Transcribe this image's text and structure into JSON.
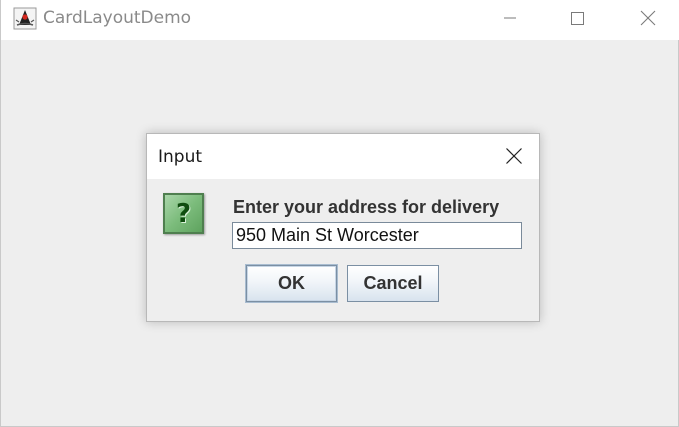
{
  "window": {
    "title": "CardLayoutDemo",
    "app_icon": "java-duke-icon",
    "controls": {
      "minimize_icon": "minimize-icon",
      "maximize_icon": "maximize-icon",
      "close_icon": "close-icon"
    }
  },
  "dialog": {
    "title": "Input",
    "close_icon": "close-icon",
    "message_icon": "question-icon",
    "message_icon_glyph": "?",
    "prompt": "Enter your address for delivery",
    "input_value": "950 Main St Worcester",
    "buttons": {
      "ok_label": "OK",
      "cancel_label": "Cancel"
    }
  },
  "colors": {
    "window_background": "#eeeeee",
    "titlebar_background": "#ffffff",
    "question_icon_green": "#7cbc7c",
    "button_border": "#7b8fa3"
  }
}
